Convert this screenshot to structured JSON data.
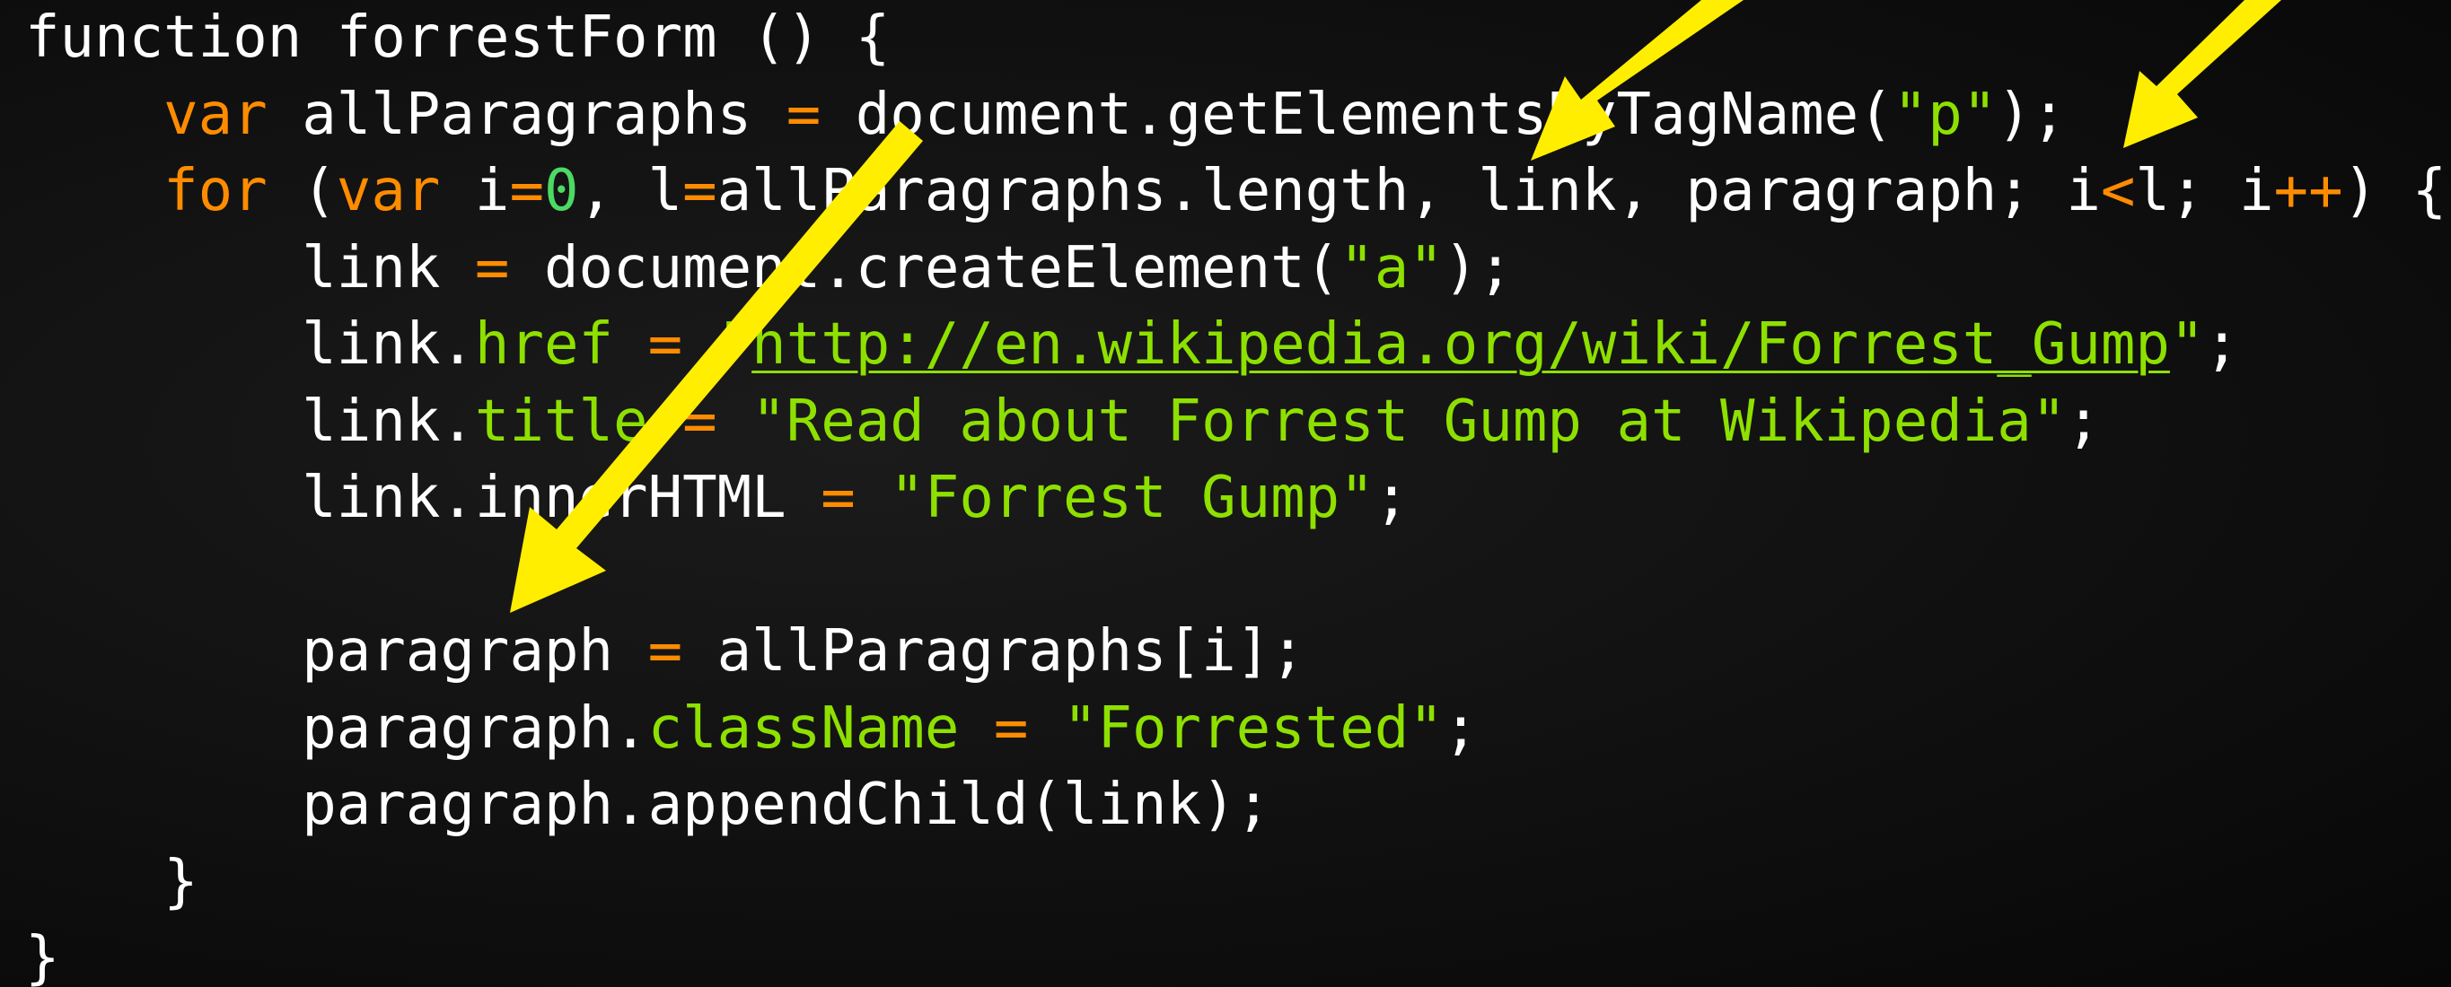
{
  "code_lines": [
    [
      {
        "t": "function",
        "c": "txt"
      },
      {
        "t": " forrestForm () {",
        "c": "txt"
      }
    ],
    [
      {
        "t": "    ",
        "c": "txt"
      },
      {
        "t": "var",
        "c": "kw"
      },
      {
        "t": " allParagraphs ",
        "c": "txt"
      },
      {
        "t": "=",
        "c": "kw"
      },
      {
        "t": " document.getElementsByTagName(",
        "c": "txt"
      },
      {
        "t": "\"p\"",
        "c": "str"
      },
      {
        "t": ");",
        "c": "txt"
      }
    ],
    [
      {
        "t": "    ",
        "c": "txt"
      },
      {
        "t": "for",
        "c": "kw"
      },
      {
        "t": " (",
        "c": "txt"
      },
      {
        "t": "var",
        "c": "kw"
      },
      {
        "t": " i",
        "c": "txt"
      },
      {
        "t": "=",
        "c": "kw"
      },
      {
        "t": "0",
        "c": "num"
      },
      {
        "t": ", l",
        "c": "txt"
      },
      {
        "t": "=",
        "c": "kw"
      },
      {
        "t": "allParagraphs.length, link, paragraph; i",
        "c": "txt"
      },
      {
        "t": "<",
        "c": "kw"
      },
      {
        "t": "l; i",
        "c": "txt"
      },
      {
        "t": "++",
        "c": "kw"
      },
      {
        "t": ") {",
        "c": "txt"
      }
    ],
    [
      {
        "t": "        link ",
        "c": "txt"
      },
      {
        "t": "=",
        "c": "kw"
      },
      {
        "t": " document.createElement(",
        "c": "txt"
      },
      {
        "t": "\"a\"",
        "c": "str"
      },
      {
        "t": ");",
        "c": "txt"
      }
    ],
    [
      {
        "t": "        link.",
        "c": "txt"
      },
      {
        "t": "href",
        "c": "prop"
      },
      {
        "t": " ",
        "c": "txt"
      },
      {
        "t": "=",
        "c": "kw"
      },
      {
        "t": " \"",
        "c": "str"
      },
      {
        "t": "http://en.wikipedia.org/wiki/Forrest_Gump",
        "c": "url"
      },
      {
        "t": "\"",
        "c": "str"
      },
      {
        "t": ";",
        "c": "txt"
      }
    ],
    [
      {
        "t": "        link.",
        "c": "txt"
      },
      {
        "t": "title",
        "c": "prop"
      },
      {
        "t": " ",
        "c": "txt"
      },
      {
        "t": "=",
        "c": "kw"
      },
      {
        "t": " \"Read about Forrest Gump at Wikipedia\"",
        "c": "str"
      },
      {
        "t": ";",
        "c": "txt"
      }
    ],
    [
      {
        "t": "        link.innerHTML ",
        "c": "txt"
      },
      {
        "t": "=",
        "c": "kw"
      },
      {
        "t": " \"Forrest Gump\"",
        "c": "str"
      },
      {
        "t": ";",
        "c": "txt"
      }
    ],
    [
      {
        "t": "",
        "c": "txt"
      }
    ],
    [
      {
        "t": "        paragraph ",
        "c": "txt"
      },
      {
        "t": "=",
        "c": "kw"
      },
      {
        "t": " allParagraphs[i];",
        "c": "txt"
      }
    ],
    [
      {
        "t": "        paragraph.",
        "c": "txt"
      },
      {
        "t": "className",
        "c": "prop"
      },
      {
        "t": " ",
        "c": "txt"
      },
      {
        "t": "=",
        "c": "kw"
      },
      {
        "t": " \"Forrested\"",
        "c": "str"
      },
      {
        "t": ";",
        "c": "txt"
      }
    ],
    [
      {
        "t": "        paragraph.appendChild(link);",
        "c": "txt"
      }
    ],
    [
      {
        "t": "    }",
        "c": "txt"
      }
    ],
    [
      {
        "t": "}",
        "c": "txt"
      }
    ]
  ],
  "colors": {
    "keyword": "#ff8c00",
    "string": "#8ee000",
    "number": "#4cd964",
    "text": "#ffffff",
    "background": "#111111",
    "arrow": "#ffee00"
  },
  "annotations": [
    {
      "name": "arrow-to-link",
      "icon": "yellow-arrow-icon",
      "points_at": "link"
    },
    {
      "name": "arrow-to-i-less-than-l",
      "icon": "yellow-arrow-icon",
      "points_at": "i<l"
    },
    {
      "name": "arrow-to-paragraph",
      "icon": "yellow-arrow-icon",
      "points_at": "paragraph"
    }
  ]
}
